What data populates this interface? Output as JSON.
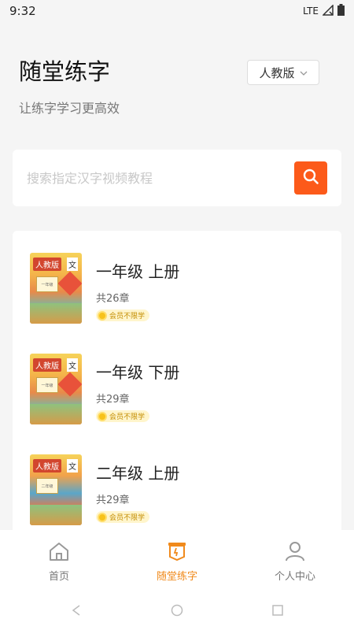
{
  "status_bar": {
    "time": "9:32",
    "network": "LTE"
  },
  "header": {
    "title": "随堂练字",
    "subtitle": "让练字学习更高效",
    "edition_label": "人教版"
  },
  "search": {
    "placeholder": "搜索指定汉字视频教程"
  },
  "books": [
    {
      "title": "一年级 上册",
      "chapters": "共26章",
      "badge": "会员不限学",
      "cover_label": "人教版",
      "cover_tag": "文",
      "cover_grade": "一年级"
    },
    {
      "title": "一年级 下册",
      "chapters": "共29章",
      "badge": "会员不限学",
      "cover_label": "人教版",
      "cover_tag": "文",
      "cover_grade": "一年级"
    },
    {
      "title": "二年级 上册",
      "chapters": "共29章",
      "badge": "会员不限学",
      "cover_label": "人教版",
      "cover_tag": "文",
      "cover_grade": "二年级"
    }
  ],
  "nav": [
    {
      "label": "首页",
      "icon": "home-icon",
      "active": false
    },
    {
      "label": "随堂练字",
      "icon": "practice-icon",
      "active": true
    },
    {
      "label": "个人中心",
      "icon": "person-icon",
      "active": false
    }
  ],
  "colors": {
    "accent": "#fc5a1a",
    "active_nav": "#f08a1c",
    "vip": "#f7c21b"
  }
}
